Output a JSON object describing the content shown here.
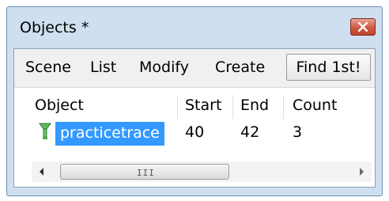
{
  "window": {
    "title": "Objects *"
  },
  "menu": {
    "items": [
      "Scene",
      "List",
      "Modify",
      "Create"
    ],
    "find_button": "Find 1st!"
  },
  "table": {
    "columns": [
      "Object",
      "Start",
      "End",
      "Count"
    ],
    "rows": [
      {
        "object": "practicetrace",
        "start": "40",
        "end": "42",
        "count": "3",
        "icon": "trace-icon",
        "selected": true
      }
    ]
  },
  "scrollbar": {
    "grip": "III"
  },
  "colors": {
    "selection": "#3399ff",
    "close_button": "#c8503a",
    "frame": "#cfdff0"
  }
}
